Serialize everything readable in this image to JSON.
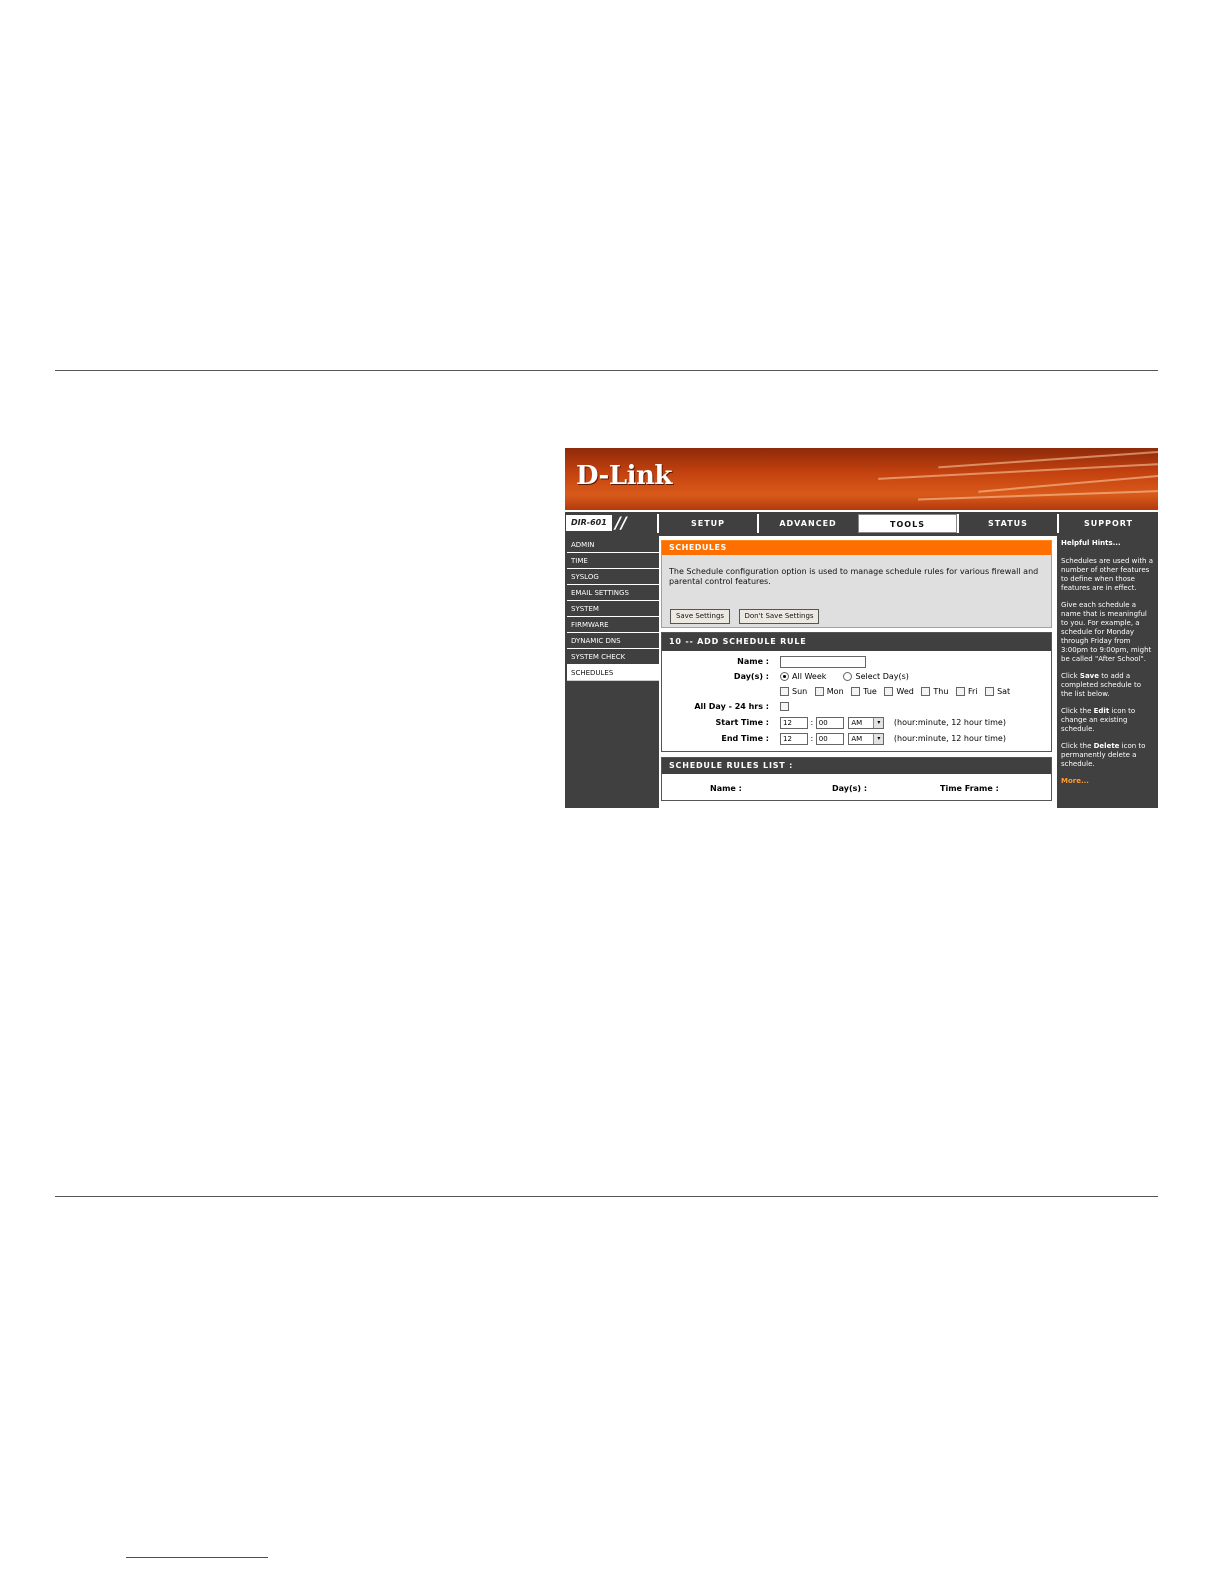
{
  "page": {
    "rules": [
      "top-rule",
      "bottom-rule"
    ]
  },
  "banner": {
    "logo": "D-Link"
  },
  "nav": {
    "model": "DIR-601",
    "slashes": "//",
    "tabs": [
      "SETUP",
      "ADVANCED",
      "TOOLS",
      "STATUS",
      "SUPPORT"
    ],
    "active_tab": "TOOLS"
  },
  "sidebar": {
    "items": [
      "ADMIN",
      "TIME",
      "SYSLOG",
      "EMAIL SETTINGS",
      "SYSTEM",
      "FIRMWARE",
      "DYNAMIC DNS",
      "SYSTEM CHECK",
      "SCHEDULES"
    ],
    "active": "SCHEDULES"
  },
  "schedules": {
    "title": "SCHEDULES",
    "description": "The Schedule configuration option is used to manage schedule rules for various firewall and parental control features.",
    "save_button": "Save Settings",
    "dont_save_button": "Don't Save Settings"
  },
  "add_rule": {
    "title": "10 -- ADD SCHEDULE RULE",
    "name_label": "Name :",
    "name_value": "",
    "days_label": "Day(s) :",
    "all_week": "All Week",
    "select_days": "Select Day(s)",
    "selected_mode": "All Week",
    "days": [
      "Sun",
      "Mon",
      "Tue",
      "Wed",
      "Thu",
      "Fri",
      "Sat"
    ],
    "all_day_label": "All Day - 24 hrs :",
    "start_label": "Start Time :",
    "end_label": "End Time :",
    "start_hour": "12",
    "start_minute": "00",
    "start_ampm": "AM",
    "end_hour": "12",
    "end_minute": "00",
    "end_ampm": "AM",
    "time_separator": ":",
    "time_hint": "(hour:minute, 12 hour time)"
  },
  "rules_list": {
    "title": "SCHEDULE RULES LIST :",
    "col_name": "Name :",
    "col_days": "Day(s) :",
    "col_timeframe": "Time Frame :"
  },
  "hints": {
    "title": "Helpful Hints...",
    "p1": "Schedules are used with a number of other features to define when those features are in effect.",
    "p2": "Give each schedule a name that is meaningful to you. For example, a schedule for Monday through Friday from 3:00pm to 9:00pm, might be called \"After School\".",
    "p3_pre": "Click ",
    "p3_bold": "Save",
    "p3_post": " to add a completed schedule to the list below.",
    "p4_pre": "Click the ",
    "p4_bold": "Edit",
    "p4_post": " icon to change an existing schedule.",
    "p5_pre": "Click the ",
    "p5_bold": "Delete",
    "p5_post": " icon to permanently delete a schedule.",
    "more": "More..."
  }
}
